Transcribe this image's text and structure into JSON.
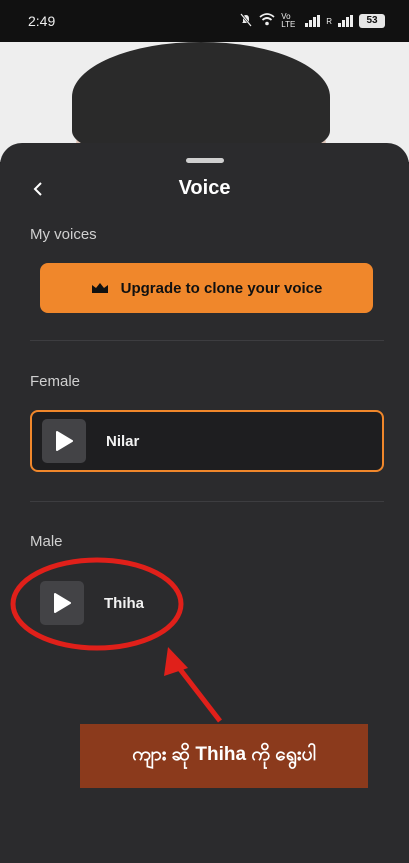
{
  "status_bar": {
    "time": "2:49",
    "network_label": "Vo LTE",
    "signal_secondary": "R",
    "battery": "53"
  },
  "sheet": {
    "title": "Voice",
    "back_icon": "chevron-left-icon",
    "my_voices_label": "My voices",
    "upgrade_button": {
      "label": "Upgrade to clone your voice",
      "icon": "crown-icon",
      "color": "#f0872b"
    },
    "female_label": "Female",
    "female_voices": [
      {
        "name": "Nilar",
        "selected": true
      }
    ],
    "male_label": "Male",
    "male_voices": [
      {
        "name": "Thiha",
        "selected": false
      }
    ]
  },
  "annotation": {
    "text": "ကျား ဆို Thiha ကို ရွေးပါ",
    "box_color": "#8b3a1c",
    "circle_color": "#e0201a"
  }
}
